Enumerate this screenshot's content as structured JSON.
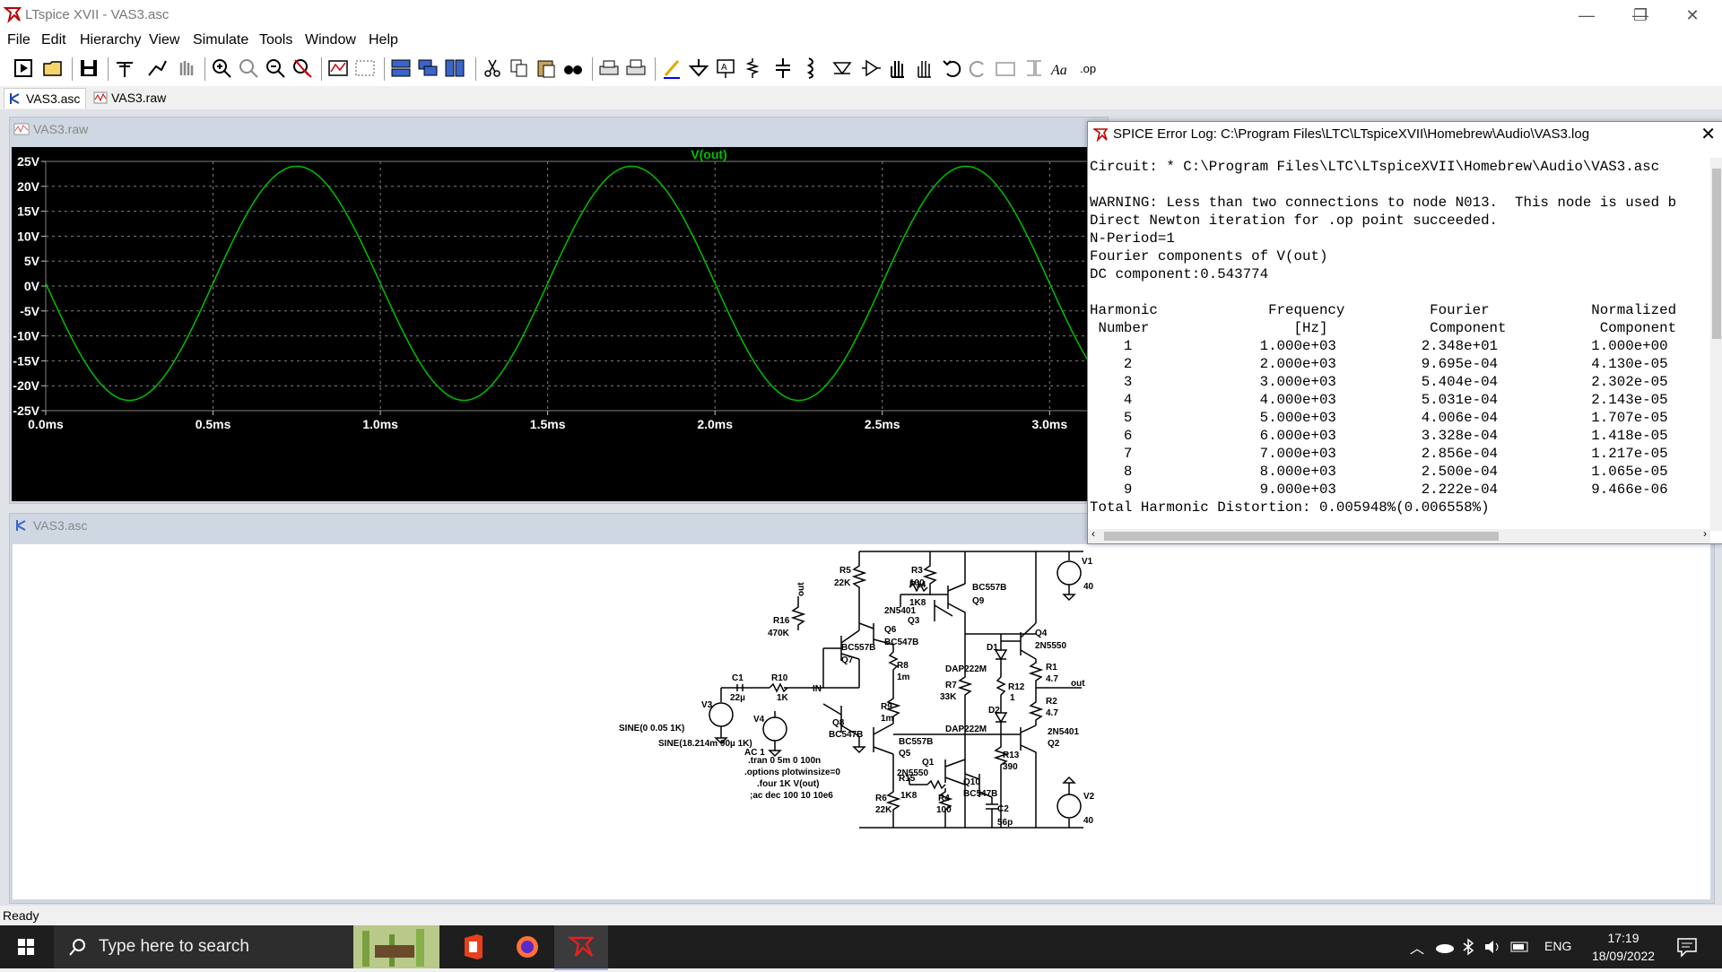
{
  "window": {
    "title": "LTspice XVII - VAS3.asc",
    "minimize": "—",
    "restore": "❐",
    "close": "✕"
  },
  "menu": [
    {
      "label": "File",
      "mnemonic": "F"
    },
    {
      "label": "Edit",
      "mnemonic": "E"
    },
    {
      "label": "Hierarchy",
      "mnemonic": "i"
    },
    {
      "label": "View",
      "mnemonic": "V"
    },
    {
      "label": "Simulate",
      "mnemonic": "S"
    },
    {
      "label": "Tools",
      "mnemonic": "T"
    },
    {
      "label": "Window",
      "mnemonic": "W"
    },
    {
      "label": "Help",
      "mnemonic": "H"
    }
  ],
  "toolbar_icons": [
    "new-schematic-icon",
    "open-icon",
    "save-icon",
    "control-panel-icon",
    "run-icon",
    "halt-icon",
    "zoom-in-icon",
    "pan-icon",
    "zoom-out-icon",
    "zoom-fit-icon",
    "autorange-icon",
    "zoom-area-icon",
    "tile-horizontal-icon",
    "cascade-icon",
    "tile-vertical-icon",
    "cut-icon",
    "copy-icon",
    "paste-icon",
    "find-icon",
    "print-icon",
    "print-preview-icon",
    "draw-wire-icon",
    "ground-icon",
    "label-net-icon",
    "resistor-icon",
    "capacitor-icon",
    "inductor-icon",
    "diode-icon",
    "component-icon",
    "move-icon",
    "drag-icon",
    "undo-icon",
    "redo-icon",
    "rotate-icon",
    "mirror-icon",
    "text-icon",
    "spice-directive-icon"
  ],
  "tabs": [
    {
      "label": "VAS3.asc",
      "icon": "schematic-icon",
      "active": true
    },
    {
      "label": "VAS3.raw",
      "icon": "waveform-icon",
      "active": false
    }
  ],
  "plot_window": {
    "title": "VAS3.raw",
    "trace_label": "V(out)",
    "trace_color": "#00c000"
  },
  "schematic_window": {
    "title": "VAS3.asc"
  },
  "chart_data": {
    "type": "line",
    "title": "",
    "xlabel": "",
    "ylabel": "",
    "x_ticks": [
      "0.0ms",
      "0.5ms",
      "1.0ms",
      "1.5ms",
      "2.0ms",
      "2.5ms",
      "3.0ms"
    ],
    "y_ticks": [
      "25V",
      "20V",
      "15V",
      "10V",
      "5V",
      "0V",
      "-5V",
      "-10V",
      "-15V",
      "-20V",
      "-25V"
    ],
    "xlim": [
      0,
      3.16
    ],
    "ylim": [
      -25,
      25
    ],
    "grid": true,
    "series": [
      {
        "name": "V(out)",
        "waveform": "sine",
        "amplitude": 23.48,
        "offset": 0.543774,
        "frequency_khz": 1,
        "phase": "inverted",
        "x_start": 0,
        "x_end": 3.16
      }
    ]
  },
  "log": {
    "title": "SPICE Error Log: C:\\Program Files\\LTC\\LTspiceXVII\\Homebrew\\Audio\\VAS3.log",
    "lines": [
      "Circuit: * C:\\Program Files\\LTC\\LTspiceXVII\\Homebrew\\Audio\\VAS3.asc",
      "",
      "WARNING: Less than two connections to node N013.  This node is used b",
      "Direct Newton iteration for .op point succeeded.",
      "N-Period=1",
      "Fourier components of V(out)",
      "DC component:0.543774",
      "",
      "Harmonic             Frequency          Fourier            Normalized",
      " Number                 [Hz]            Component           Component",
      "    1               1.000e+03          2.348e+01           1.000e+00",
      "    2               2.000e+03          9.695e-04           4.130e-05",
      "    3               3.000e+03          5.404e-04           2.302e-05",
      "    4               4.000e+03          5.031e-04           2.143e-05",
      "    5               5.000e+03          4.006e-04           1.707e-05",
      "    6               6.000e+03          3.328e-04           1.418e-05",
      "    7               7.000e+03          2.856e-04           1.217e-05",
      "    8               8.000e+03          2.500e-04           1.065e-05",
      "    9               9.000e+03          2.222e-04           9.466e-06",
      "Total Harmonic Distortion: 0.005948%(0.006558%)"
    ]
  },
  "schematic": {
    "labels": {
      "R5": "R5",
      "R5v": "22K",
      "R3": "R3",
      "R3v": "100",
      "R14": "R14",
      "R14v": "1K8",
      "Q3n": "2N5401",
      "Q3": "Q3",
      "Q9n": "BC557B",
      "Q9": "Q9",
      "out_top": "out",
      "R16": "R16",
      "R16v": "470K",
      "Q6": "Q6",
      "Q6n": "BC547B",
      "Q7n": "BC557B",
      "Q7": "Q7",
      "R8": "R8",
      "R8v": "1m",
      "D1": "D1",
      "D1n": "DAP222M",
      "Q4": "Q4",
      "Q4n": "2N5550",
      "R1": "R1",
      "R1v": "4.7",
      "C1": "C1",
      "C1v": "22µ",
      "R10": "R10",
      "R10v": "1K",
      "IN": "IN",
      "R7": "R7",
      "R7v": "33K",
      "R12": "R12",
      "R12v": "1",
      "out": "out",
      "V3": "V3",
      "R9": "R9",
      "R9v": "1m",
      "D2": "D2",
      "D2n": "DAP222M",
      "R2": "R2",
      "R2v": "4.7",
      "V4": "V4",
      "Q8": "Q8",
      "Q8n": "BC547B",
      "V3src": "SINE(0 0.05 1K)",
      "V4src": "SINE(18.214m 90µ 1K)",
      "V4ac": "AC 1",
      "Q5n": "BC557B",
      "Q5": "Q5",
      "Q2n": "2N5401",
      "Q2": "Q2",
      "R13": "R13",
      "R13v": "390",
      "Q1": "Q1",
      "Q1n": "2N5550",
      "R15": "R15",
      "R15v": "1K8",
      "Q10": "Q10",
      "Q10n": "BC547B",
      "R6": "R6",
      "R6v": "22K",
      "R4": "R4",
      "R4v": "100",
      "C2": "C2",
      "C2v": "56p",
      "V1": "V1",
      "V1v": "40",
      "V2": "V2",
      "V2v": "40"
    },
    "directives": [
      ".tran 0 5m 0 100n",
      ".options plotwinsize=0",
      ".four 1K V(out)",
      ";ac dec 100 10 10e6"
    ]
  },
  "status": {
    "text": "Ready"
  },
  "taskbar": {
    "search_placeholder": "Type here to search",
    "apps": [
      "widgets-icon",
      "office-icon",
      "firefox-icon",
      "ltspice-icon"
    ],
    "tray": {
      "language": "ENG",
      "time": "17:19",
      "date": "18/09/2022"
    }
  }
}
